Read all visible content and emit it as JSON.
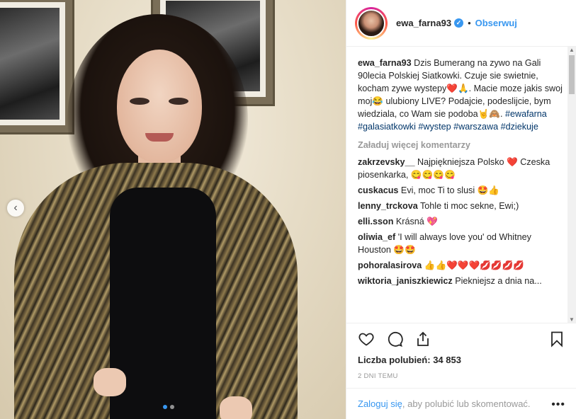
{
  "post": {
    "username": "ewa_farna93",
    "separator": "•",
    "follow_label": "Obserwuj",
    "caption_text": "Dzis Bumerang na zywo na Gali 90lecia Polskiej Siatkowki. Czuje sie swietnie, kocham zywe wystepy❤️🙏. Macie moze jakis swoj moj😂 ulubiony LIVE? Podajcie, podeslijcie, bym wiedziala, co Wam sie podoba🤘🙈.",
    "hashtags": [
      "#ewafarna",
      "#galasiatkowki",
      "#wystep",
      "#warszawa",
      "#dziekuje"
    ],
    "load_more": "Załaduj więcej komentarzy",
    "likes_label": "Liczba polubień:",
    "likes_count": "34 853",
    "time": "2 dni temu"
  },
  "comments": [
    {
      "user": "zakrzevsky__",
      "text": "Najpiękniejsza Polsko ❤️ Czeska piosenkarka, 😋😋😋😋"
    },
    {
      "user": "cuskacus",
      "text": "Evi, moc Ti to slusi 🤩👍"
    },
    {
      "user": "lenny_trckova",
      "text": "Tohle ti moc sekne, Ewi;)"
    },
    {
      "user": "elli.sson",
      "text": "Krásná 💖"
    },
    {
      "user": "oliwia_ef",
      "text": "'I will always love you' od Whitney Houston 🤩🤩"
    },
    {
      "user": "pohoralasirova",
      "text": "👍👍❤️❤️❤️💋💋💋💋"
    },
    {
      "user": "wiktoria_janiszkiewicz",
      "text": "Piekniejsz a dnia na..."
    }
  ],
  "footer": {
    "login_link": "Zaloguj się",
    "login_text": ", aby polubić lub skomentować.",
    "more_options": "•••"
  },
  "colors": {
    "accent": "#3897f0",
    "hashtag": "#003569",
    "muted": "#999999"
  }
}
